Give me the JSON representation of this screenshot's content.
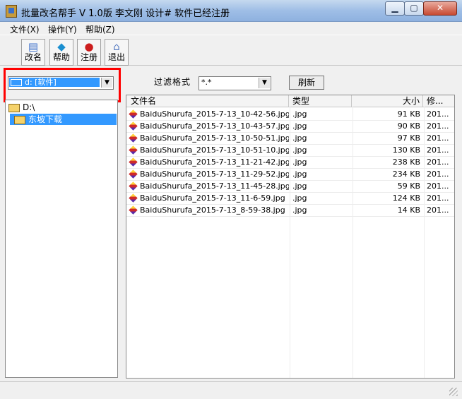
{
  "window": {
    "title": "批量改名帮手  V 1.0版  李文刚 设计# 软件已经注册",
    "min_glyph": "▁",
    "max_glyph": "▢",
    "close_glyph": "✕"
  },
  "menu": [
    "文件(X)",
    "操作(Y)",
    "帮助(Z)"
  ],
  "toolbar": [
    {
      "label": "改名",
      "icon": "rename-icon",
      "glyph": "▤"
    },
    {
      "label": "帮助",
      "icon": "help-icon",
      "glyph": "◆"
    },
    {
      "label": "注册",
      "icon": "register-icon",
      "glyph": "●"
    },
    {
      "label": "退出",
      "icon": "exit-icon",
      "glyph": "⌂"
    }
  ],
  "drive": {
    "selected": "d: [软件]",
    "arrow": "▼"
  },
  "tree": [
    {
      "label": "D:\\",
      "selected": false
    },
    {
      "label": "东坡下载",
      "selected": true
    }
  ],
  "filter": {
    "label": "过滤格式",
    "value": "*.*",
    "arrow": "▼"
  },
  "refresh_label": "刷新",
  "columns": [
    "文件名",
    "类型",
    "大小",
    "修..."
  ],
  "files": [
    {
      "name": "BaiduShurufa_2015-7-13_10-42-56.jpg",
      "type": ".jpg",
      "size": "91 KB",
      "mod": "201..."
    },
    {
      "name": "BaiduShurufa_2015-7-13_10-43-57.jpg",
      "type": ".jpg",
      "size": "90 KB",
      "mod": "201..."
    },
    {
      "name": "BaiduShurufa_2015-7-13_10-50-51.jpg",
      "type": ".jpg",
      "size": "97 KB",
      "mod": "201..."
    },
    {
      "name": "BaiduShurufa_2015-7-13_10-51-10.jpg",
      "type": ".jpg",
      "size": "130 KB",
      "mod": "201..."
    },
    {
      "name": "BaiduShurufa_2015-7-13_11-21-42.jpg",
      "type": ".jpg",
      "size": "238 KB",
      "mod": "201..."
    },
    {
      "name": "BaiduShurufa_2015-7-13_11-29-52.jpg",
      "type": ".jpg",
      "size": "234 KB",
      "mod": "201..."
    },
    {
      "name": "BaiduShurufa_2015-7-13_11-45-28.jpg",
      "type": ".jpg",
      "size": "59 KB",
      "mod": "201..."
    },
    {
      "name": "BaiduShurufa_2015-7-13_11-6-59.jpg",
      "type": ".jpg",
      "size": "124 KB",
      "mod": "201..."
    },
    {
      "name": "BaiduShurufa_2015-7-13_8-59-38.jpg",
      "type": ".jpg",
      "size": "14 KB",
      "mod": "201..."
    }
  ]
}
